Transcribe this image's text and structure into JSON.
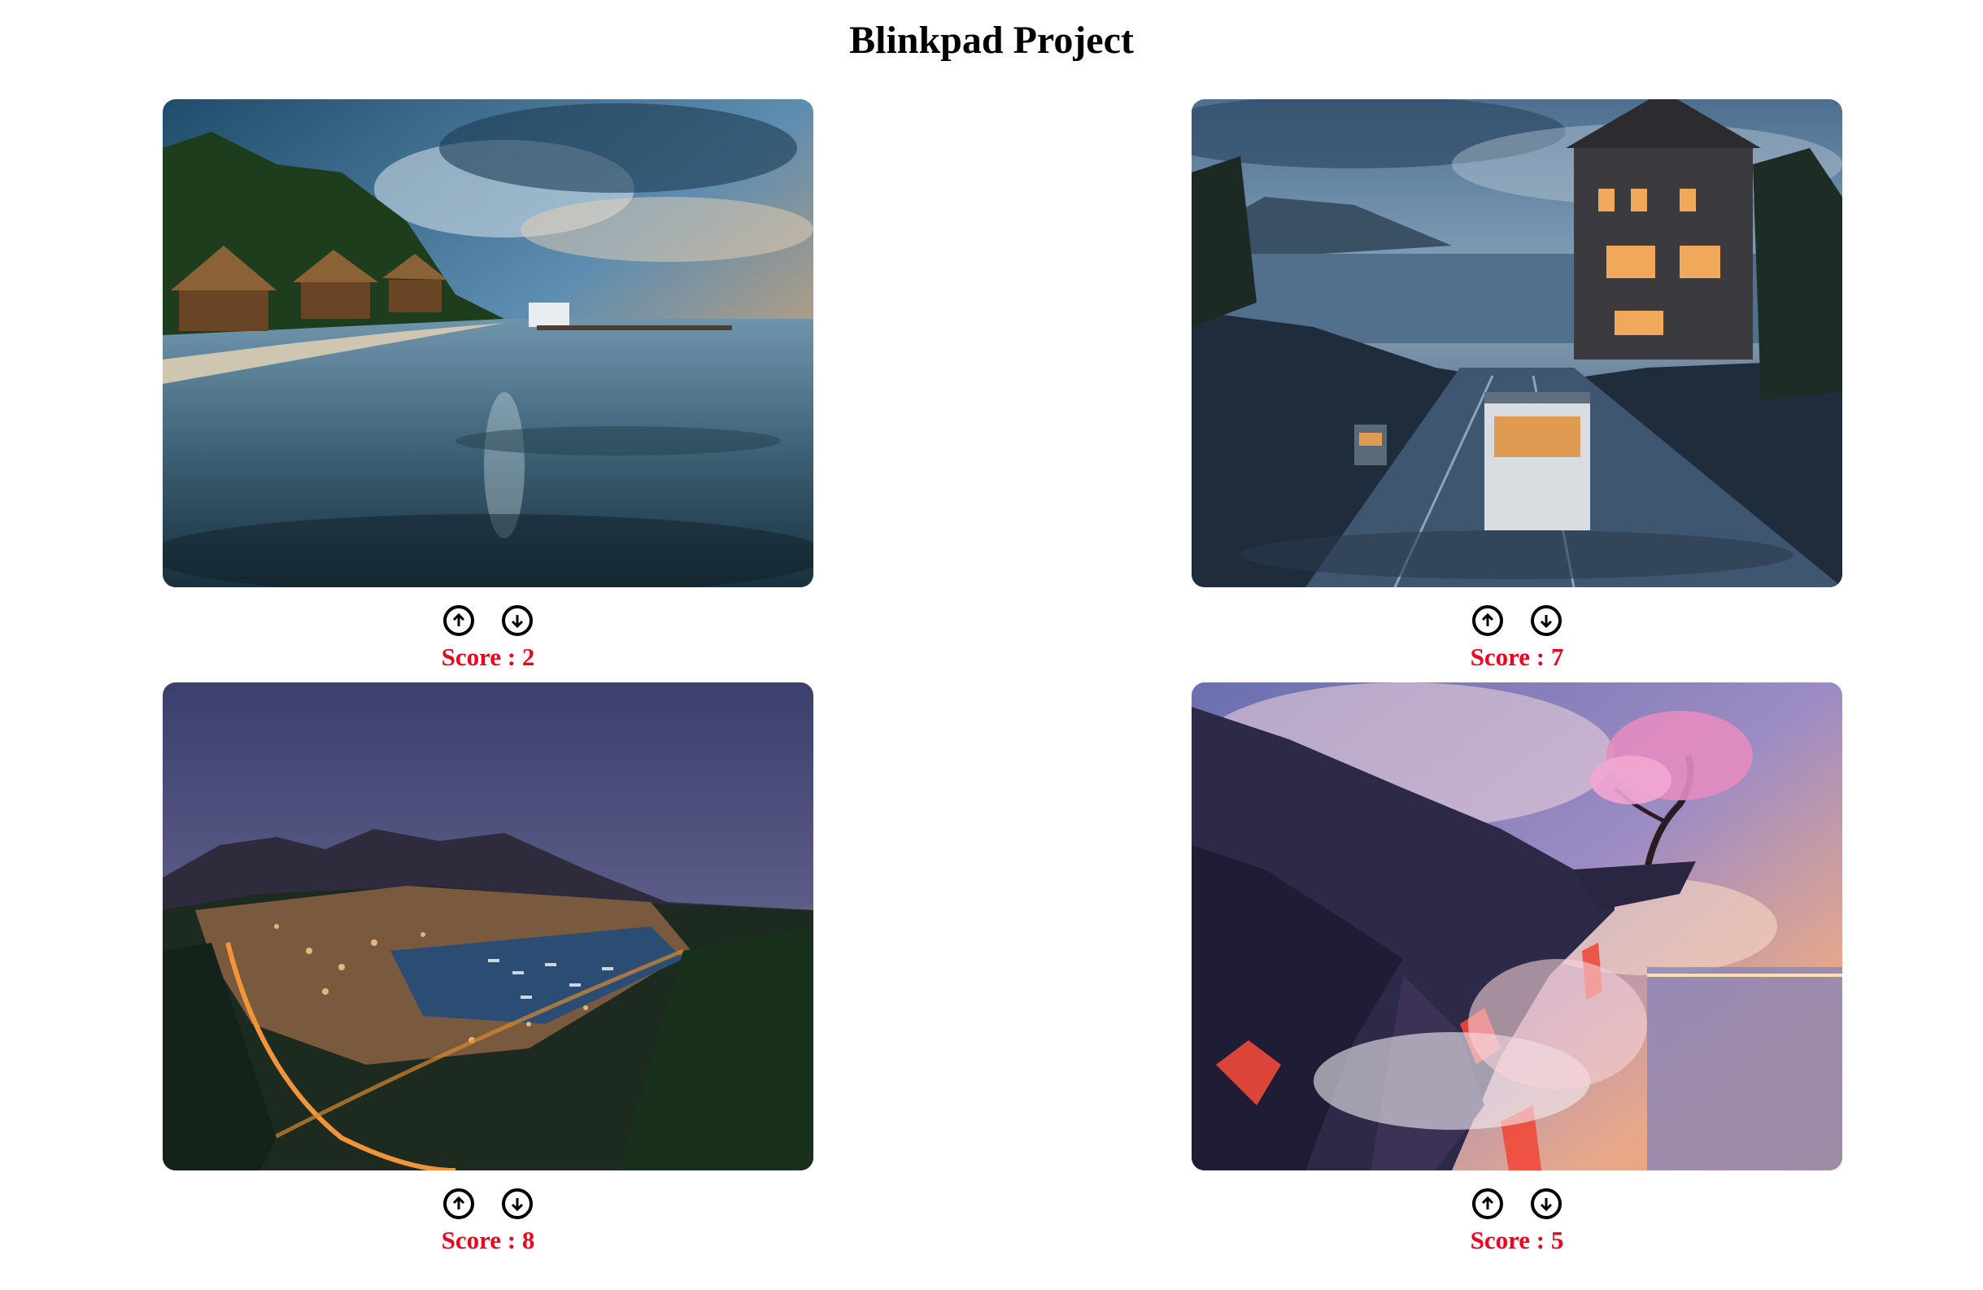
{
  "page": {
    "title": "Blinkpad Project"
  },
  "cards": [
    {
      "scene": "tropical-beach-huts-photo",
      "score_text": "Score : 2",
      "upvote_icon": "arrow-up-circle-icon",
      "downvote_icon": "arrow-down-circle-icon"
    },
    {
      "scene": "rainy-city-cable-car-painting",
      "score_text": "Score : 7",
      "upvote_icon": "arrow-up-circle-icon",
      "downvote_icon": "arrow-down-circle-icon"
    },
    {
      "scene": "night-harbor-city-panorama-photo",
      "score_text": "Score : 8",
      "upvote_icon": "arrow-up-circle-icon",
      "downvote_icon": "arrow-down-circle-icon"
    },
    {
      "scene": "lava-cliff-cherry-tree-painting",
      "score_text": "Score : 5",
      "upvote_icon": "arrow-up-circle-icon",
      "downvote_icon": "arrow-down-circle-icon"
    }
  ],
  "colors": {
    "score": "#f0001c",
    "background": "#ffffff",
    "text": "#000000"
  }
}
